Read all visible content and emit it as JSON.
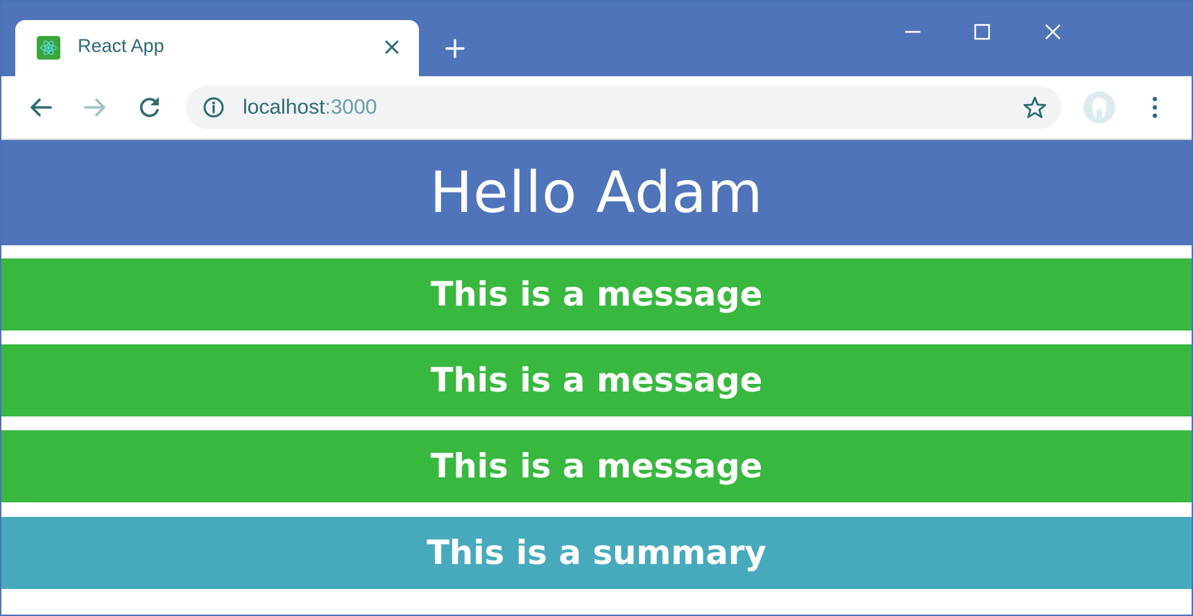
{
  "browser": {
    "tab_title": "React App",
    "url_host": "localhost",
    "url_port": ":3000"
  },
  "page": {
    "heading": "Hello Adam",
    "messages": [
      "This is a message",
      "This is a message",
      "This is a message"
    ],
    "summary": "This is a summary"
  },
  "colors": {
    "header": "#4f74b9",
    "message": "#38b83f",
    "summary": "#46aabc"
  }
}
